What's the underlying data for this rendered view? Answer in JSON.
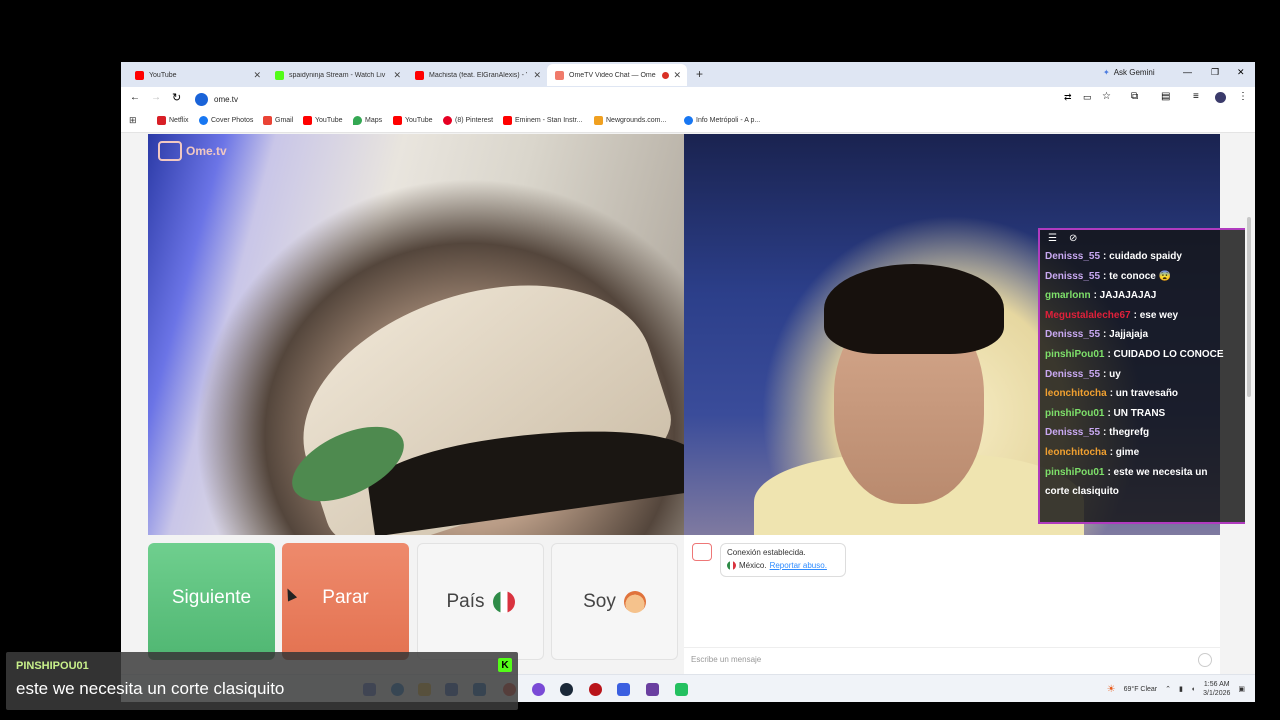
{
  "browser": {
    "tabs": [
      {
        "title": "YouTube",
        "icon": "youtube-icon",
        "color": "#ff0000",
        "active": false
      },
      {
        "title": "spaidyninja Stream - Watch Liv",
        "icon": "kick-icon",
        "color": "#53fc18",
        "active": false
      },
      {
        "title": "Machista (feat. ElGranAlexis) - Y",
        "icon": "youtube-icon",
        "color": "#ff0000",
        "active": false
      },
      {
        "title": "OmeTV Video Chat — Ome",
        "icon": "ometv-icon",
        "color": "#f07a6a",
        "active": true
      }
    ],
    "ask_gemini": "Ask Gemini",
    "url": "ome.tv",
    "bookmarks": [
      "Netflix",
      "Cover Photos",
      "Gmail",
      "YouTube",
      "Maps",
      "YouTube",
      "(8) Pinterest",
      "Eminem - Stan Instr...",
      "Newgrounds.com...",
      "Info Metrópoli - A p..."
    ]
  },
  "ometv": {
    "logo_text": "Ome.tv",
    "buttons": {
      "next": "Siguiente",
      "stop": "Parar",
      "country": "País",
      "gender": "Soy"
    },
    "connection": {
      "status": "Conexión establecida.",
      "country": "México.",
      "report": "Reportar abuso."
    },
    "input_placeholder": "Escribe un mensaje"
  },
  "chat_overlay": {
    "messages": [
      {
        "user": "Denisss_55",
        "text": ": cuidado spaidy",
        "color": "#c9a9f2"
      },
      {
        "user": "Denisss_55",
        "text": ": te conoce 😨",
        "color": "#c9a9f2"
      },
      {
        "user": "gmarlonn",
        "text": ": JAJAJAJAJ",
        "color": "#7ee06a"
      },
      {
        "user": "Megustalaleche67",
        "text": ": ese wey",
        "color": "#e0203a"
      },
      {
        "user": "Denisss_55",
        "text": ": Jajjajaja",
        "color": "#c9a9f2"
      },
      {
        "user": "pinshiPou01",
        "text": ": CUIDADO LO CONOCE",
        "color": "#7ee06a"
      },
      {
        "user": "Denisss_55",
        "text": ": uy",
        "color": "#c9a9f2"
      },
      {
        "user": "leonchitocha",
        "text": ": un travesaño",
        "color": "#f0a030"
      },
      {
        "user": "pinshiPou01",
        "text": ": UN TRANS",
        "color": "#7ee06a"
      },
      {
        "user": "Denisss_55",
        "text": ": thegrefg",
        "color": "#c9a9f2"
      },
      {
        "user": "leonchitocha",
        "text": ": gime",
        "color": "#f0a030"
      },
      {
        "user": "pinshiPou01",
        "text": ": este we necesita un",
        "color": "#7ee06a"
      },
      {
        "user": "",
        "text": "corte clasiquito",
        "color": "#ffffff"
      }
    ]
  },
  "taskbar": {
    "weather": "69°F  Clear",
    "time": "1:56 AM",
    "date": "3/1/2026"
  },
  "stream_caption": {
    "user": "PINSHIPOU01",
    "text": "este we necesita un corte clasiquito"
  }
}
